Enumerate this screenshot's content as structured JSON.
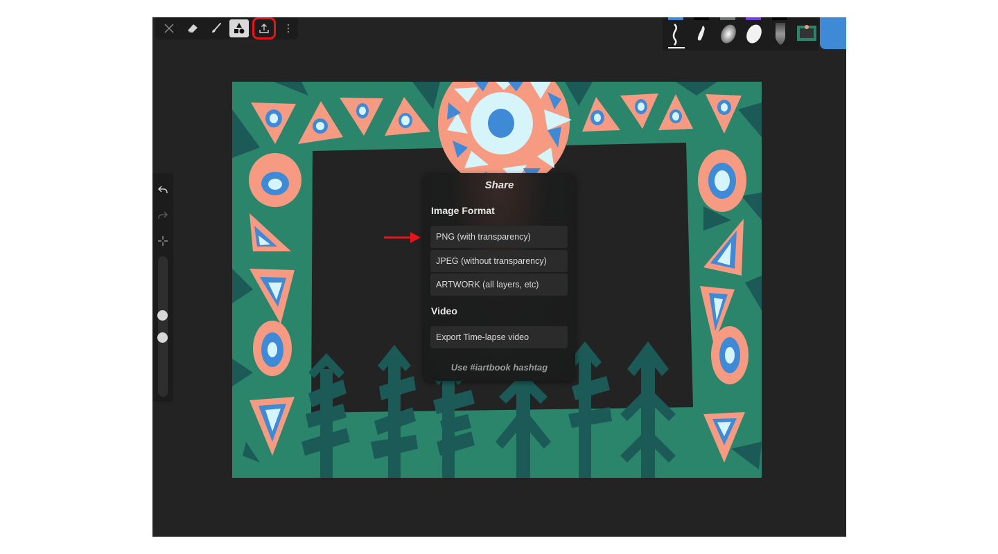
{
  "toolbar": {
    "tools": [
      {
        "name": "close",
        "icon": "close-icon",
        "active": false
      },
      {
        "name": "eraser",
        "icon": "eraser-icon",
        "active": false
      },
      {
        "name": "brush",
        "icon": "brush-icon",
        "active": false
      },
      {
        "name": "shapes",
        "icon": "shapes-icon",
        "active": true
      },
      {
        "name": "share",
        "icon": "share-icon",
        "active": false,
        "highlighted": true
      },
      {
        "name": "more",
        "icon": "more-vertical-icon",
        "active": false
      }
    ]
  },
  "brushes": [
    {
      "name": "pen",
      "bar_color": "#3e8ad6",
      "selected": true
    },
    {
      "name": "ink",
      "bar_color": "#000000",
      "selected": false
    },
    {
      "name": "airbrush",
      "bar_color": "#6e7479",
      "selected": false
    },
    {
      "name": "marker",
      "bar_color": "#7a3be6",
      "selected": false
    },
    {
      "name": "smudge",
      "bar_color": "#000000",
      "selected": false
    },
    {
      "name": "pattern",
      "bar_color": null,
      "selected": false
    }
  ],
  "current_color": "#3e8ad6",
  "sidebar": {
    "undo": "undo-icon",
    "redo": "redo-icon",
    "crosshair": "crosshair-icon",
    "size_slider_value": 0.4,
    "opacity_slider_value": 0.55
  },
  "share_panel": {
    "title": "Share",
    "image_format_heading": "Image Format",
    "options": [
      "PNG (with transparency)",
      "JPEG (without transparency)",
      "ARTWORK (all layers, etc)"
    ],
    "video_heading": "Video",
    "video_option": "Export Time-lapse video",
    "hashtag": "Use #iartbook hashtag"
  },
  "annotations": {
    "highlight_color": "#e8141c"
  },
  "colors": {
    "green": "#2a856b",
    "dark_green": "#1c5a57",
    "salmon": "#f79a82",
    "blue": "#3e8ad6",
    "light_blue": "#d6f5fb",
    "dark_bg": "#232323"
  }
}
